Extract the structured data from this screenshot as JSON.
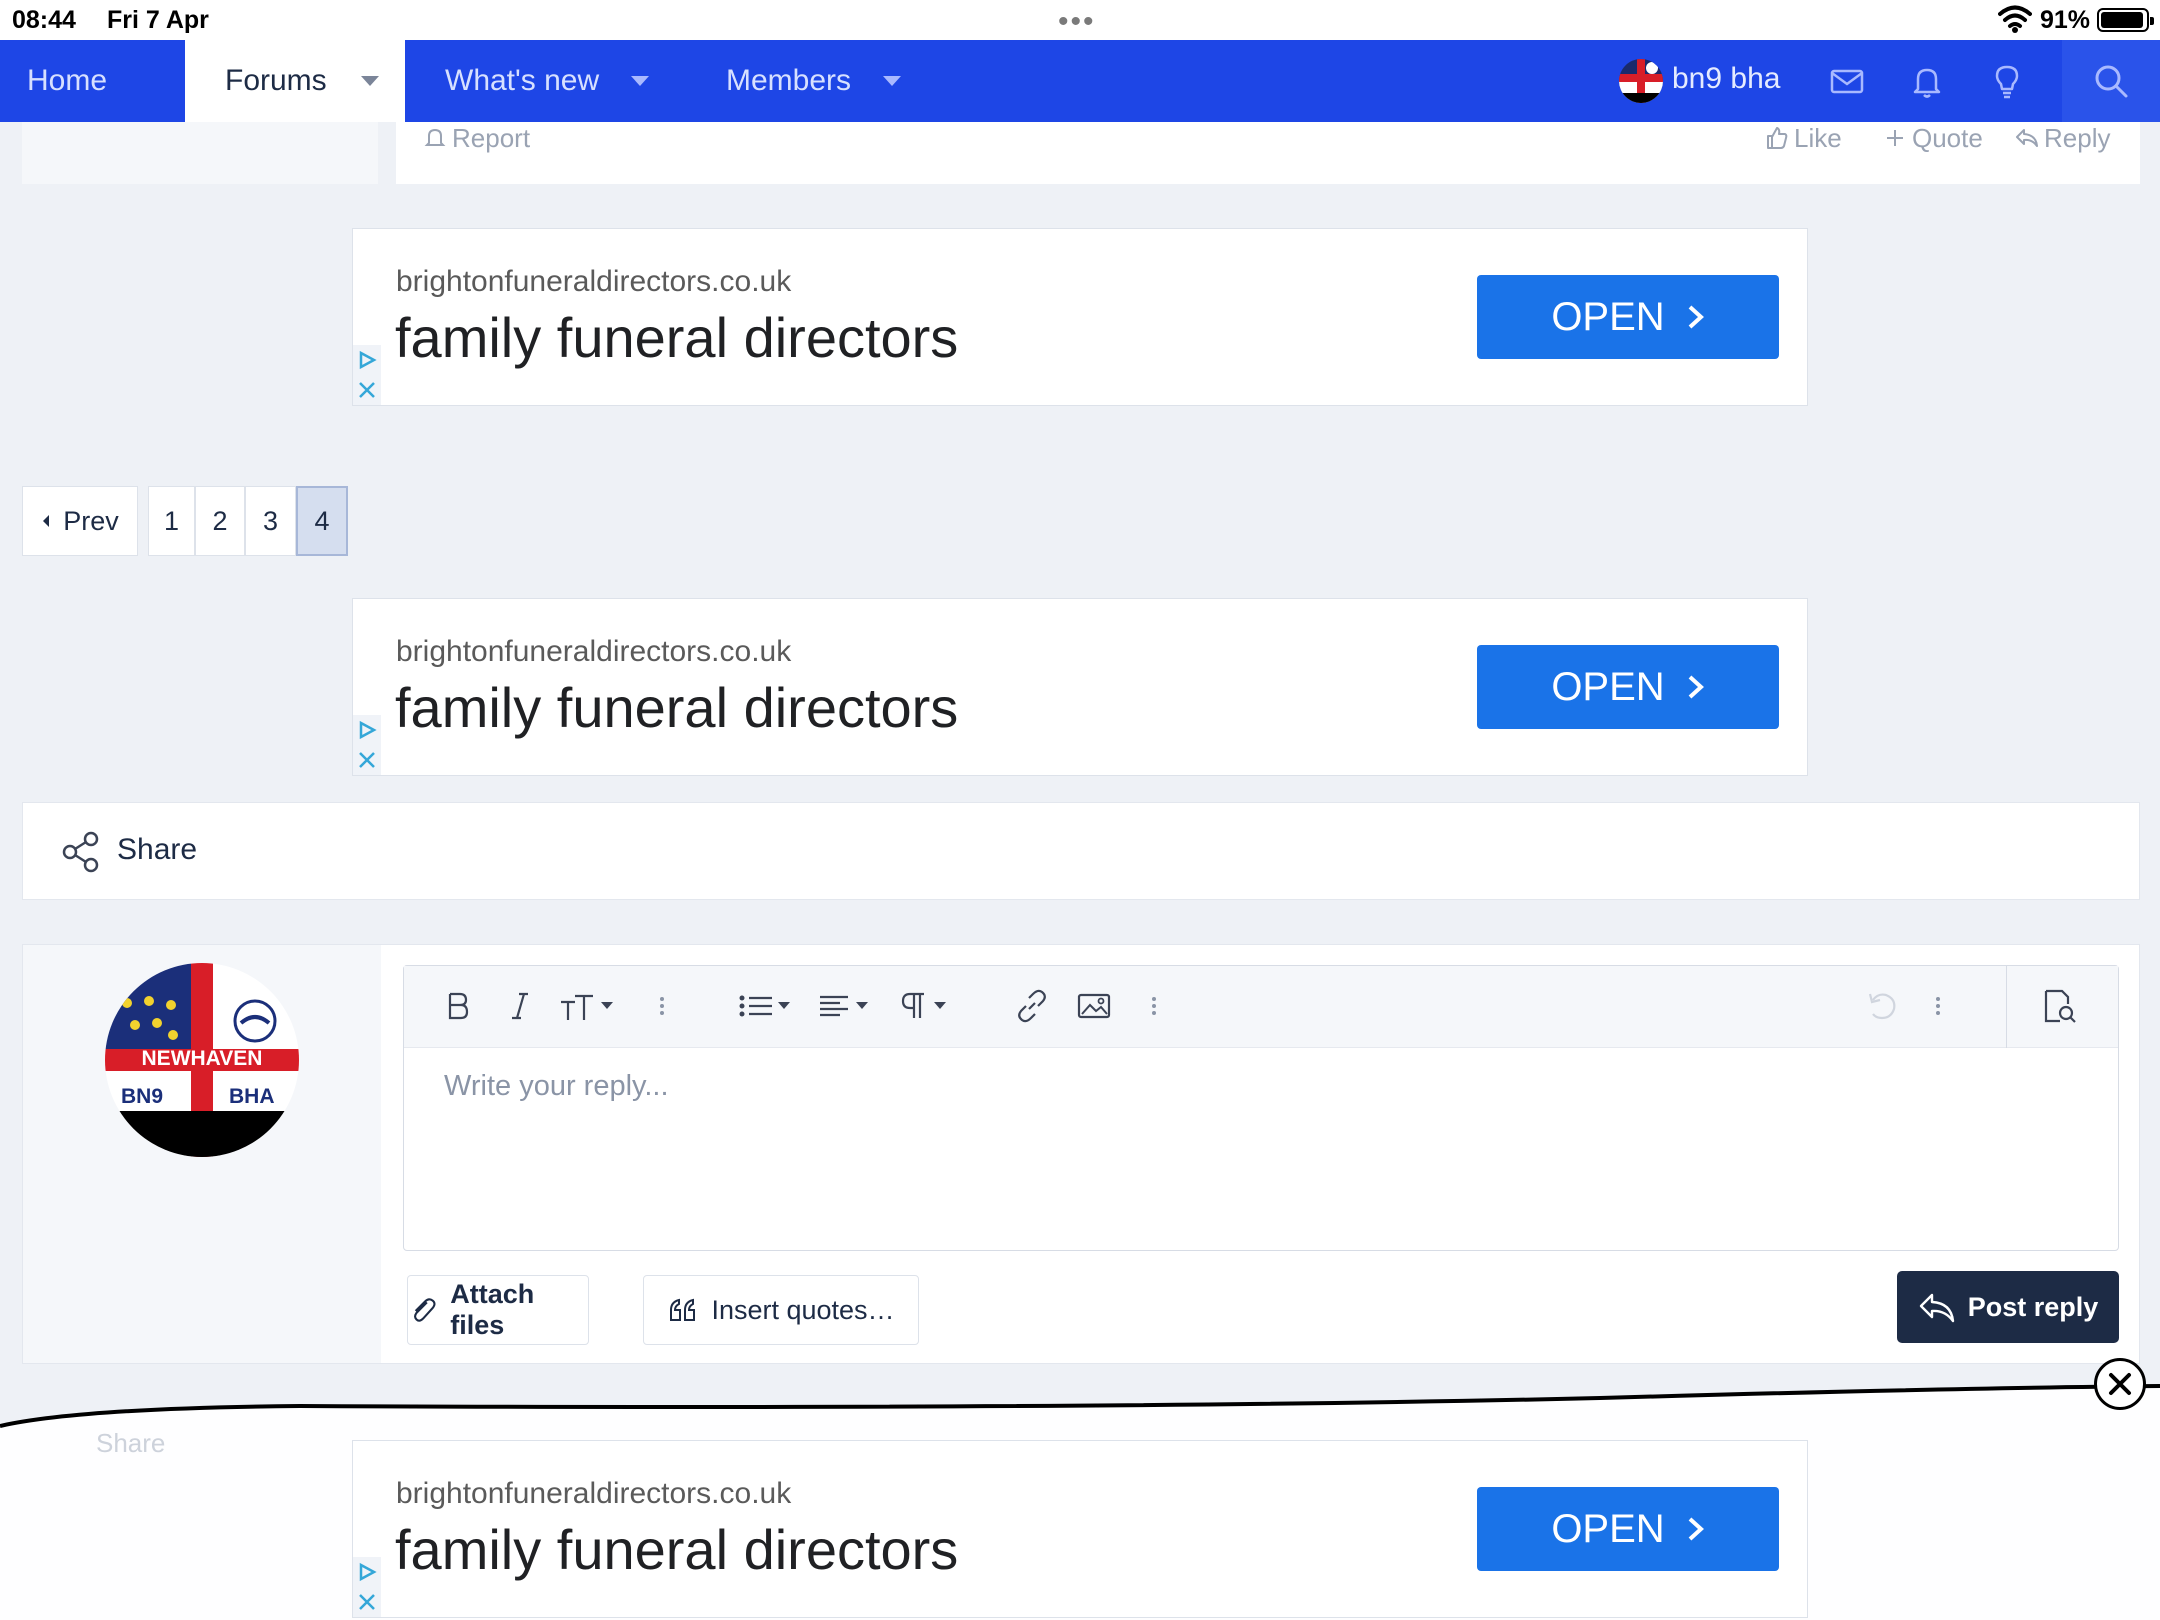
{
  "status_bar": {
    "time": "08:44",
    "date": "Fri 7 Apr",
    "battery": "91%"
  },
  "nav": {
    "tabs": [
      {
        "label": "Home"
      },
      {
        "label": "Forums"
      },
      {
        "label": "What's new"
      },
      {
        "label": "Members"
      }
    ],
    "username": "bn9 bha"
  },
  "post_footer": {
    "report": "Report",
    "like": "Like",
    "quote": "Quote",
    "reply": "Reply"
  },
  "ads": [
    {
      "domain": "brightonfuneraldirectors.co.uk",
      "headline": "family funeral directors",
      "button": "OPEN"
    },
    {
      "domain": "brightonfuneraldirectors.co.uk",
      "headline": "family funeral directors",
      "button": "OPEN"
    },
    {
      "domain": "brightonfuneraldirectors.co.uk",
      "headline": "family funeral directors",
      "button": "OPEN"
    }
  ],
  "pagination": {
    "prev": "Prev",
    "pages": [
      "1",
      "2",
      "3",
      "4"
    ],
    "current": "4"
  },
  "share": {
    "label": "Share"
  },
  "reply": {
    "avatar": {
      "top_text": "NEWHAVEN",
      "left_text": "BN9",
      "right_text": "BHA"
    },
    "placeholder": "Write your reply...",
    "attach": "Attach files",
    "insert_quotes": "Insert quotes…",
    "post_reply": "Post reply"
  },
  "ghost": {
    "share": "Share"
  },
  "colors": {
    "nav": "#1e46e6",
    "ad_button": "#1a73e8",
    "post_reply": "#1d2b45"
  }
}
